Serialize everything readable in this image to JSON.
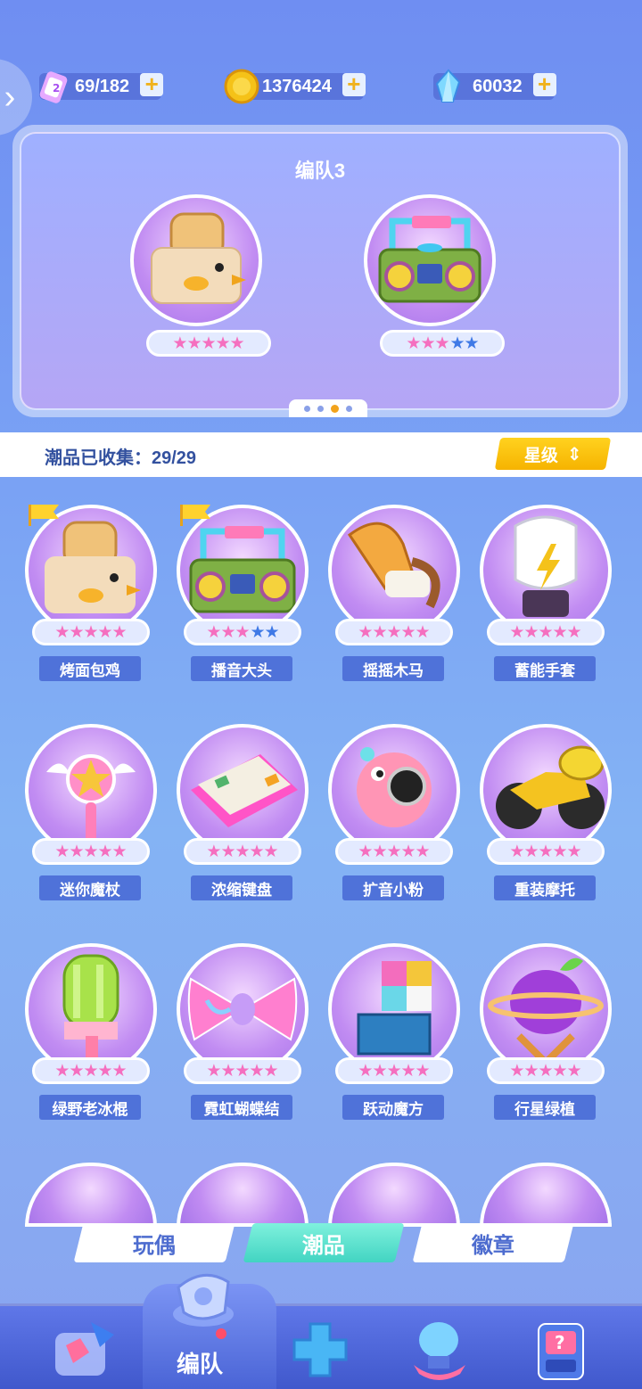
{
  "resources": {
    "energy": {
      "value": "69/182",
      "icon": "battery-icon"
    },
    "coins": {
      "value": "1376424",
      "icon": "coin-icon"
    },
    "gems": {
      "value": "60032",
      "icon": "crystal-icon"
    },
    "plus": "+"
  },
  "back_arrow": "›",
  "team": {
    "title": "编队3",
    "members": [
      {
        "name": "烤面包鸡",
        "stars_on": "★★★★★",
        "stars_off": ""
      },
      {
        "name": "播音大头",
        "stars_on": "★★★",
        "stars_off": "★★"
      }
    ],
    "page_index": 3,
    "page_count": 4
  },
  "collection": {
    "label": "潮品已收集：29/29",
    "sort_label": "星级",
    "sort_icon": "⇕"
  },
  "items": [
    {
      "name": "烤面包鸡",
      "stars_on": "★★★★★",
      "stars_off": "",
      "flag": true
    },
    {
      "name": "播音大头",
      "stars_on": "★★★",
      "stars_off": "★★",
      "flag": true
    },
    {
      "name": "摇摇木马",
      "stars_on": "★★★★★",
      "stars_off": "",
      "flag": false
    },
    {
      "name": "蓄能手套",
      "stars_on": "★★★★★",
      "stars_off": "",
      "flag": false
    },
    {
      "name": "迷你魔杖",
      "stars_on": "★★★★★",
      "stars_off": "",
      "flag": false
    },
    {
      "name": "浓缩键盘",
      "stars_on": "★★★★★",
      "stars_off": "",
      "flag": false
    },
    {
      "name": "扩音小粉",
      "stars_on": "★★★★★",
      "stars_off": "",
      "flag": false
    },
    {
      "name": "重装摩托",
      "stars_on": "★★★★★",
      "stars_off": "",
      "flag": false
    },
    {
      "name": "绿野老冰棍",
      "stars_on": "★★★★★",
      "stars_off": "",
      "flag": false
    },
    {
      "name": "霓虹蝴蝶结",
      "stars_on": "★★★★★",
      "stars_off": "",
      "flag": false
    },
    {
      "name": "跃动魔方",
      "stars_on": "★★★★★",
      "stars_off": "",
      "flag": false
    },
    {
      "name": "行星绿植",
      "stars_on": "★★★★★",
      "stars_off": "",
      "flag": false
    }
  ],
  "sub_tabs": [
    {
      "label": "玩偶",
      "active": false
    },
    {
      "label": "潮品",
      "active": true
    },
    {
      "label": "徽章",
      "active": false
    }
  ],
  "nav": {
    "active_label": "编队",
    "items": [
      "home-icon",
      "whistle-icon",
      "controller-icon",
      "trophy-icon",
      "mystery-box-icon"
    ]
  },
  "colors": {
    "accent": "#f2a31c",
    "star_on": "#f56fbf",
    "star_off": "#3f79e6",
    "label_bg": "#4f72d9",
    "active_tab": "#42d4c2"
  }
}
